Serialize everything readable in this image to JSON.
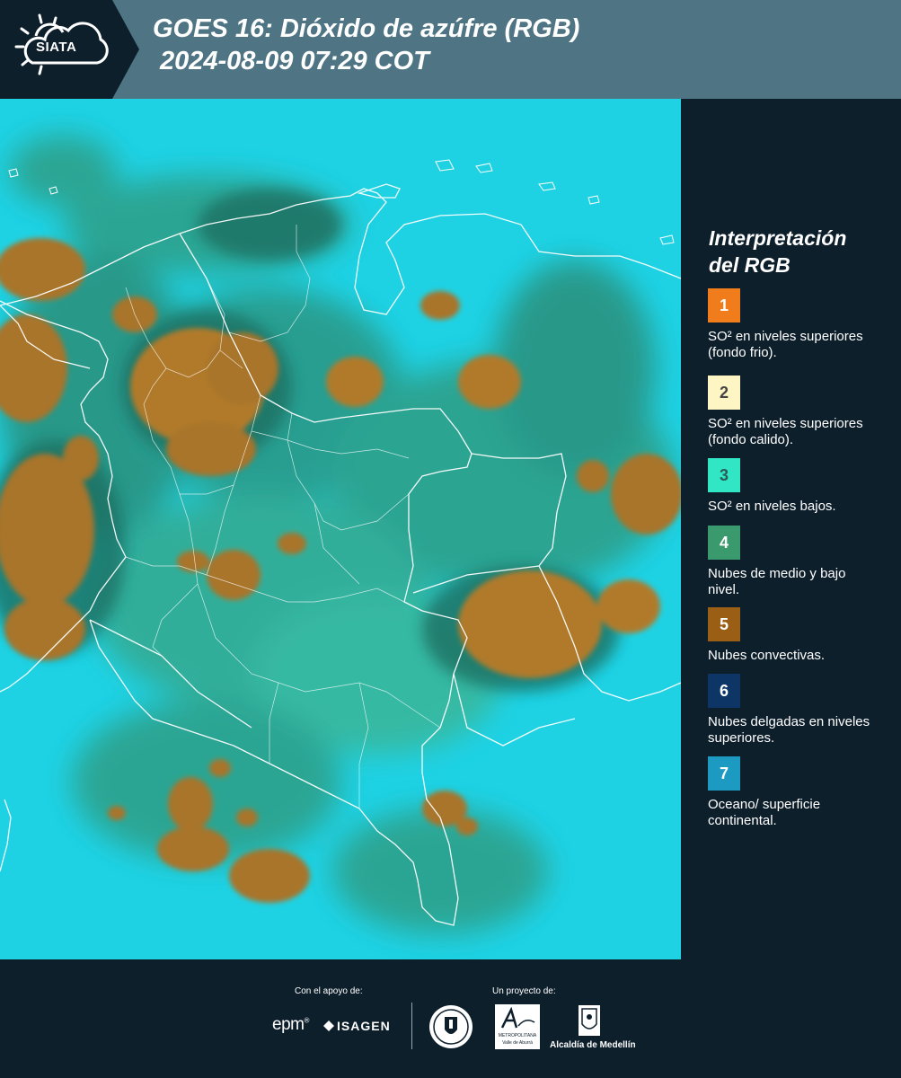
{
  "header": {
    "logo_text": "SIATA",
    "title_line1": "GOES 16: Dióxido de azúfre (RGB)",
    "title_line2": "2024-08-09 07:29 COT"
  },
  "legend": {
    "title_line1": "Interpretación",
    "title_line2": "del RGB",
    "items": [
      {
        "number": "1",
        "label": "SO² en niveles superiores (fondo frio).",
        "color": "#f07c1c",
        "text_color": "#ffffff"
      },
      {
        "number": "2",
        "label": "SO² en niveles superiores (fondo calido).",
        "color": "#fdf6c4",
        "text_color": "#444444"
      },
      {
        "number": "3",
        "label": "SO² en niveles bajos.",
        "color": "#31e6c5",
        "text_color": "#2a5a55"
      },
      {
        "number": "4",
        "label": "Nubes de medio y bajo nivel.",
        "color": "#3a9a6e",
        "text_color": "#ffffff"
      },
      {
        "number": "5",
        "label": "Nubes convectivas.",
        "color": "#9a5f14",
        "text_color": "#ffffff"
      },
      {
        "number": "6",
        "label": "Nubes delgadas en niveles superiores.",
        "color": "#0d3566",
        "text_color": "#ffffff"
      },
      {
        "number": "7",
        "label": "Oceano/ superficie continental.",
        "color": "#1d9ac2",
        "text_color": "#ffffff"
      }
    ]
  },
  "footer": {
    "support_label": "Con el apoyo de:",
    "project_label": "Un proyecto de:",
    "sponsors": {
      "epm": "epm",
      "isagen": "ISAGEN",
      "area_line1": "METROPOLITANA",
      "area_line2": "Valle de Aburrá",
      "alcaldia": "Alcaldía de Medellín"
    }
  },
  "colors": {
    "header_bg": "#4f7585",
    "logo_bg": "#0e1f2c",
    "panel_bg": "#0e1f2c",
    "ocean": "#1ed2e4",
    "convective": "#a8742a",
    "low_cloud": "#2f9e86"
  }
}
